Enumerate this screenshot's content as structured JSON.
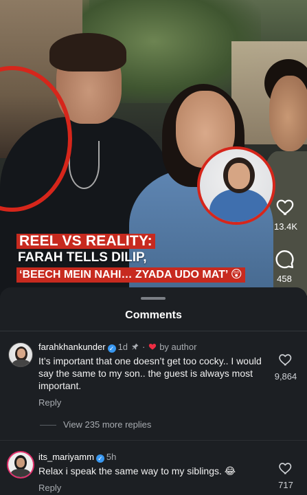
{
  "video": {
    "headline_line1": "REEL VS REALITY:",
    "headline_line2": "FARAH TELLS DILIP,",
    "headline_line3": "‘BEECH MEIN NAHI… ZYADA UDO MAT’",
    "headline_emoji": "😲",
    "like_count": "13.4K",
    "comment_count": "458",
    "like_icon": "heart-outline-icon",
    "comment_icon": "comment-bubble-icon",
    "accent_color": "#c72a1f"
  },
  "sheet": {
    "title": "Comments",
    "view_more_replies": "View 235 more replies"
  },
  "comments": [
    {
      "username": "farahkhankunder",
      "verified": true,
      "time": "1d",
      "pinned_icon": "pin-icon",
      "liked_by_author": "by author",
      "text": "It’s important that one doesn’t get too cocky.. I would say the same to my son.. the guest is always most important.",
      "reply_label": "Reply",
      "likes": "9,864"
    },
    {
      "username": "its_mariyamm",
      "verified": true,
      "time": "5h",
      "text": "Relax i speak the same way to my siblings. 😂",
      "reply_label": "Reply",
      "likes": "717"
    }
  ]
}
